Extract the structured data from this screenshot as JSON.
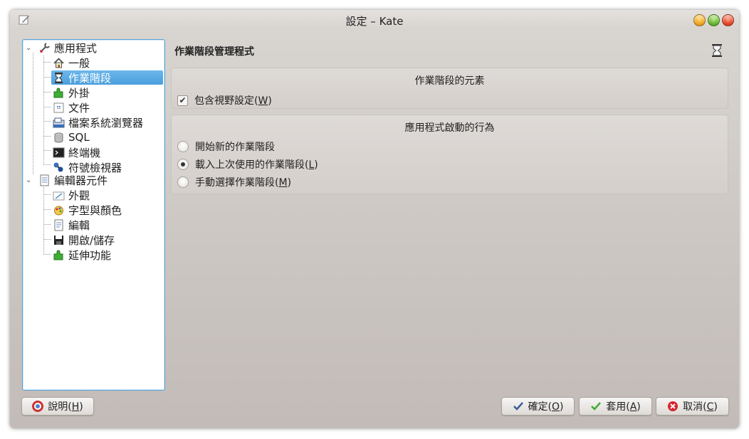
{
  "window": {
    "title": "設定 – Kate"
  },
  "tree": {
    "items": [
      {
        "label": "應用程式",
        "icon": "wrench-icon",
        "level": 0,
        "expanded": true
      },
      {
        "label": "一般",
        "icon": "home-icon",
        "level": 1
      },
      {
        "label": "作業階段",
        "icon": "hourglass-icon",
        "level": 1,
        "selected": true
      },
      {
        "label": "外掛",
        "icon": "plugin-icon",
        "level": 1
      },
      {
        "label": "文件",
        "icon": "document-icon",
        "level": 1
      },
      {
        "label": "檔案系統瀏覽器",
        "icon": "file-browser-icon",
        "level": 1
      },
      {
        "label": "SQL",
        "icon": "database-icon",
        "level": 1
      },
      {
        "label": "終端機",
        "icon": "terminal-icon",
        "level": 1
      },
      {
        "label": "符號檢視器",
        "icon": "symbol-viewer-icon",
        "level": 1
      },
      {
        "label": "編輯器元件",
        "icon": "editor-icon",
        "level": 0,
        "expanded": true
      },
      {
        "label": "外觀",
        "icon": "appearance-icon",
        "level": 1
      },
      {
        "label": "字型與顏色",
        "icon": "fonts-colors-icon",
        "level": 1
      },
      {
        "label": "編輯",
        "icon": "edit-icon",
        "level": 1
      },
      {
        "label": "開啟/儲存",
        "icon": "save-icon",
        "level": 1
      },
      {
        "label": "延伸功能",
        "icon": "extension-icon",
        "level": 1
      }
    ]
  },
  "page": {
    "title": "作業階段管理程式",
    "icon": "hourglass-icon"
  },
  "elements_group": {
    "title": "作業階段的元素",
    "checkbox_label_pre": "包含視野設定(",
    "checkbox_mnemonic": "W",
    "checkbox_label_post": ")",
    "checked": true
  },
  "startup_group": {
    "title": "應用程式啟動的行為",
    "options": [
      {
        "pre": "開始新的作業階段",
        "mn": "",
        "post": "",
        "selected": false
      },
      {
        "pre": "載入上次使用的作業階段(",
        "mn": "L",
        "post": ")",
        "selected": true
      },
      {
        "pre": "手動選擇作業階段(",
        "mn": "M",
        "post": ")",
        "selected": false
      }
    ]
  },
  "buttons": {
    "help": {
      "pre": "說明(",
      "mn": "H",
      "post": ")",
      "icon": "help-icon"
    },
    "ok": {
      "pre": "確定(",
      "mn": "O",
      "post": ")",
      "icon": "ok-check-icon"
    },
    "apply": {
      "pre": "套用(",
      "mn": "A",
      "post": ")",
      "icon": "apply-check-icon"
    },
    "cancel": {
      "pre": "取消(",
      "mn": "C",
      "post": ")",
      "icon": "cancel-icon"
    }
  },
  "colors": {
    "selection": "#4a9edb",
    "window_bg": "#cdc8c4"
  }
}
